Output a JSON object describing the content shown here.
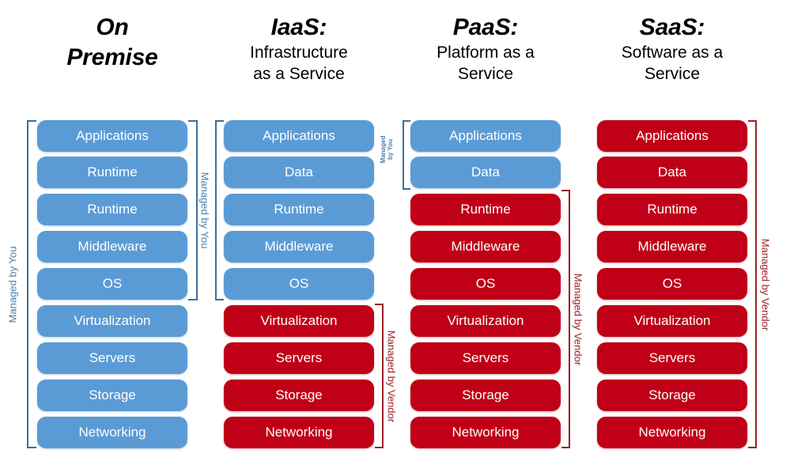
{
  "diagram": {
    "title_visible": false,
    "layers": [
      "Applications",
      "Data",
      "Runtime",
      "Middleware",
      "OS",
      "Virtualization",
      "Servers",
      "Storage",
      "Networking"
    ],
    "colors": {
      "managed_by_you": "#5b9bd5",
      "managed_by_vendor": "#c00016",
      "bracket_blue": "#3c6e9c",
      "bracket_red": "#9c2028",
      "label_blue": "#4a7fae",
      "label_red": "#9c2028",
      "pill_text": "#ffffff",
      "header_text": "#000000",
      "background": "#ffffff"
    },
    "columns": [
      {
        "id": "on-premise",
        "acronym": "On",
        "acronym_line2": "Premise",
        "expansion": "",
        "rows": [
          {
            "label": "Applications",
            "owner": "you"
          },
          {
            "label": "Runtime",
            "owner": "you"
          },
          {
            "label": "Runtime",
            "owner": "you"
          },
          {
            "label": "Middleware",
            "owner": "you"
          },
          {
            "label": "OS",
            "owner": "you"
          },
          {
            "label": "Virtualization",
            "owner": "you"
          },
          {
            "label": "Servers",
            "owner": "you"
          },
          {
            "label": "Storage",
            "owner": "you"
          },
          {
            "label": "Networking",
            "owner": "you"
          }
        ],
        "left_label": "Managed by You",
        "right_label": "Managed by You"
      },
      {
        "id": "iaas",
        "acronym": "IaaS:",
        "acronym_line2": "",
        "expansion": "Infrastructure\nas a Service",
        "expansion_line1": "Infrastructure",
        "expansion_line2": "as a Service",
        "rows": [
          {
            "label": "Applications",
            "owner": "you"
          },
          {
            "label": "Data",
            "owner": "you"
          },
          {
            "label": "Runtime",
            "owner": "you"
          },
          {
            "label": "Middleware",
            "owner": "you"
          },
          {
            "label": "OS",
            "owner": "you"
          },
          {
            "label": "Virtualization",
            "owner": "vendor"
          },
          {
            "label": "Servers",
            "owner": "vendor"
          },
          {
            "label": "Storage",
            "owner": "vendor"
          },
          {
            "label": "Networking",
            "owner": "vendor"
          }
        ],
        "you_label_line1": "Managed",
        "you_label_line2": "by You",
        "vendor_label": "Managed by Vendor"
      },
      {
        "id": "paas",
        "acronym": "PaaS:",
        "acronym_line2": "",
        "expansion_line1": "Platform as a",
        "expansion_line2": "Service",
        "rows": [
          {
            "label": "Applications",
            "owner": "you"
          },
          {
            "label": "Data",
            "owner": "you"
          },
          {
            "label": "Runtime",
            "owner": "vendor"
          },
          {
            "label": "Middleware",
            "owner": "vendor"
          },
          {
            "label": "OS",
            "owner": "vendor"
          },
          {
            "label": "Virtualization",
            "owner": "vendor"
          },
          {
            "label": "Servers",
            "owner": "vendor"
          },
          {
            "label": "Storage",
            "owner": "vendor"
          },
          {
            "label": "Networking",
            "owner": "vendor"
          }
        ],
        "vendor_label": "Managed by Vendor"
      },
      {
        "id": "saas",
        "acronym": "SaaS:",
        "acronym_line2": "",
        "expansion_line1": "Software as a",
        "expansion_line2": "Service",
        "rows": [
          {
            "label": "Applications",
            "owner": "vendor"
          },
          {
            "label": "Data",
            "owner": "vendor"
          },
          {
            "label": "Runtime",
            "owner": "vendor"
          },
          {
            "label": "Middleware",
            "owner": "vendor"
          },
          {
            "label": "OS",
            "owner": "vendor"
          },
          {
            "label": "Virtualization",
            "owner": "vendor"
          },
          {
            "label": "Servers",
            "owner": "vendor"
          },
          {
            "label": "Storage",
            "owner": "vendor"
          },
          {
            "label": "Networking",
            "owner": "vendor"
          }
        ],
        "vendor_label": "Managed by Vendor"
      }
    ]
  }
}
